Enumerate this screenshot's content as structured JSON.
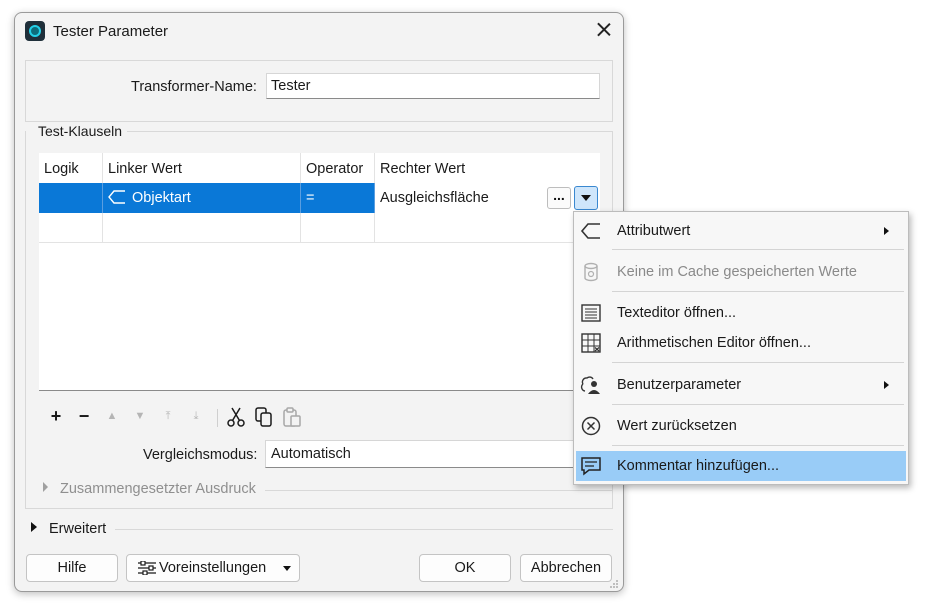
{
  "dialog": {
    "title": "Tester Parameter"
  },
  "transformer": {
    "label": "Transformer-Name:",
    "value": "Tester"
  },
  "test_clauses": {
    "group_title": "Test-Klauseln",
    "columns": [
      "Logik",
      "Linker Wert",
      "Operator",
      "Rechter Wert"
    ],
    "rows": [
      {
        "logic": "",
        "left": "Objektart",
        "operator": "=",
        "right": "Ausgleichsfläche",
        "selected": true
      },
      {
        "logic": "",
        "left": "",
        "operator": "",
        "right": "",
        "selected": false
      }
    ],
    "dots_label": "..."
  },
  "toolbar": {
    "add": "+",
    "remove": "−"
  },
  "comparison": {
    "label": "Vergleichsmodus:",
    "value": "Automatisch"
  },
  "compound_label": "Zusammengesetzter Ausdruck",
  "advanced_label": "Erweitert",
  "buttons": {
    "help": "Hilfe",
    "presets": "Voreinstellungen",
    "ok": "OK",
    "cancel": "Abbrechen"
  },
  "context_menu": {
    "items": [
      {
        "label": "Attributwert",
        "icon": "attribute-icon",
        "submenu": true,
        "disabled": false
      },
      {
        "label": "Keine im Cache gespeicherten Werte",
        "icon": "cache-icon",
        "submenu": false,
        "disabled": true
      },
      {
        "label": "Texteditor öffnen...",
        "icon": "text-editor-icon",
        "submenu": false,
        "disabled": false
      },
      {
        "label": "Arithmetischen Editor öffnen...",
        "icon": "calculator-icon",
        "submenu": false,
        "disabled": false
      },
      {
        "label": "Benutzerparameter",
        "icon": "user-parameter-icon",
        "submenu": true,
        "disabled": false
      },
      {
        "label": "Wert zurücksetzen",
        "icon": "reset-icon",
        "submenu": false,
        "disabled": false
      },
      {
        "label": "Kommentar hinzufügen...",
        "icon": "comment-icon",
        "submenu": false,
        "disabled": false,
        "highlighted": true
      }
    ]
  },
  "colors": {
    "selection": "#0a78d7",
    "menu_highlight": "#99ccf7",
    "dialog_bg": "#f3f3f3"
  }
}
